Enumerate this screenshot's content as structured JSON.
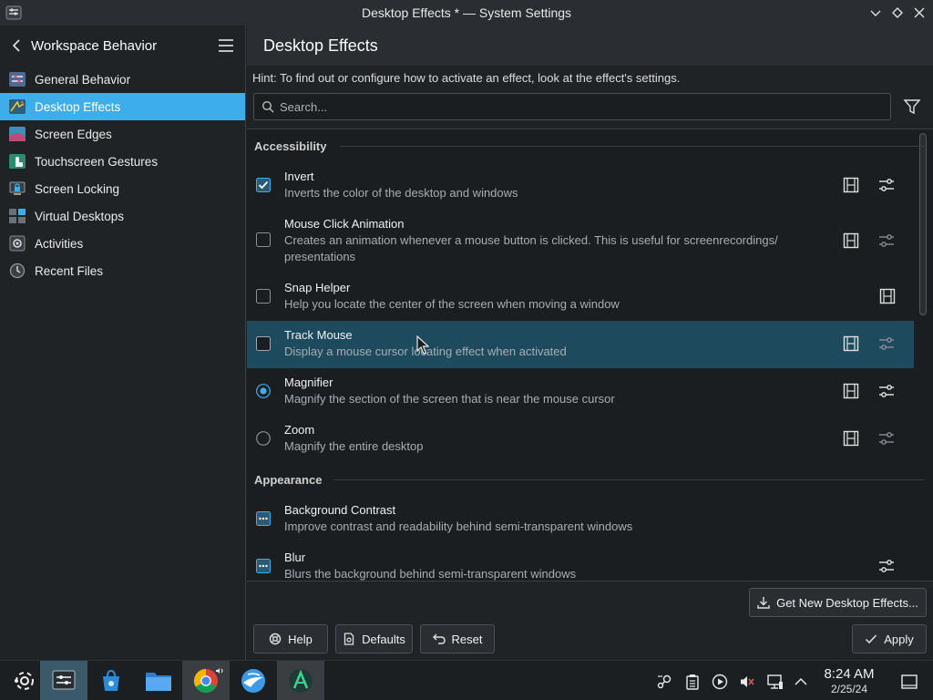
{
  "window": {
    "title": "Desktop Effects * — System Settings"
  },
  "sidebar": {
    "title": "Workspace Behavior",
    "items": [
      {
        "label": "General Behavior",
        "icon": "general-behavior-icon"
      },
      {
        "label": "Desktop Effects",
        "icon": "desktop-effects-icon",
        "active": true
      },
      {
        "label": "Screen Edges",
        "icon": "screen-edges-icon"
      },
      {
        "label": "Touchscreen Gestures",
        "icon": "touchscreen-gestures-icon"
      },
      {
        "label": "Screen Locking",
        "icon": "screen-locking-icon"
      },
      {
        "label": "Virtual Desktops",
        "icon": "virtual-desktops-icon"
      },
      {
        "label": "Activities",
        "icon": "activities-icon"
      },
      {
        "label": "Recent Files",
        "icon": "recent-files-icon"
      }
    ]
  },
  "main": {
    "title": "Desktop Effects",
    "hint": "Hint: To find out or configure how to activate an effect, look at the effect's settings.",
    "search_placeholder": "Search...",
    "sections": [
      {
        "title": "Accessibility",
        "effects": [
          {
            "name": "Invert",
            "desc": [
              "Inverts the color of the desktop and windows"
            ],
            "control": "checkbox",
            "checked": true,
            "video": true,
            "config": true
          },
          {
            "name": "Mouse Click Animation",
            "desc": [
              "Creates an animation whenever a mouse button is clicked. This is useful for screenrecordings/",
              "presentations"
            ],
            "control": "checkbox",
            "checked": false,
            "video": true,
            "config": true
          },
          {
            "name": "Snap Helper",
            "desc": [
              "Help you locate the center of the screen when moving a window"
            ],
            "control": "checkbox",
            "checked": false,
            "video": true,
            "config": false
          },
          {
            "name": "Track Mouse",
            "desc": [
              "Display a mouse cursor locating effect when activated"
            ],
            "control": "checkbox",
            "checked": false,
            "video": true,
            "config": true,
            "highlighted": true
          },
          {
            "name": "Magnifier",
            "desc": [
              "Magnify the section of the screen that is near the mouse cursor"
            ],
            "control": "radio",
            "checked": true,
            "video": true,
            "config": true
          },
          {
            "name": "Zoom",
            "desc": [
              "Magnify the entire desktop"
            ],
            "control": "radio",
            "checked": false,
            "video": true,
            "config": true
          }
        ]
      },
      {
        "title": "Appearance",
        "effects": [
          {
            "name": "Background Contrast",
            "desc": [
              "Improve contrast and readability behind semi-transparent windows"
            ],
            "control": "dots",
            "checked": true,
            "video": false,
            "config": false
          },
          {
            "name": "Blur",
            "desc": [
              "Blurs the background behind semi-transparent windows"
            ],
            "control": "dots",
            "checked": true,
            "video": false,
            "config": true
          }
        ]
      }
    ],
    "buttons": {
      "get_new": "Get New Desktop Effects...",
      "help": "Help",
      "defaults": "Defaults",
      "reset": "Reset",
      "apply": "Apply"
    }
  },
  "taskbar": {
    "apps": [
      "application-launcher-icon",
      "system-settings-icon",
      "discover-store-icon",
      "file-manager-icon",
      "chrome-icon",
      "web-browser-icon",
      "vector-app-icon"
    ],
    "tray": [
      "steam-icon",
      "clipboard-icon",
      "media-player-icon",
      "volume-muted-icon",
      "network-icon",
      "expand-tray-icon"
    ],
    "time": "8:24 AM",
    "date": "2/25/24"
  },
  "colors": {
    "accent": "#3daee9",
    "highlight_row": "#1e4a5e",
    "background": "#202326"
  }
}
